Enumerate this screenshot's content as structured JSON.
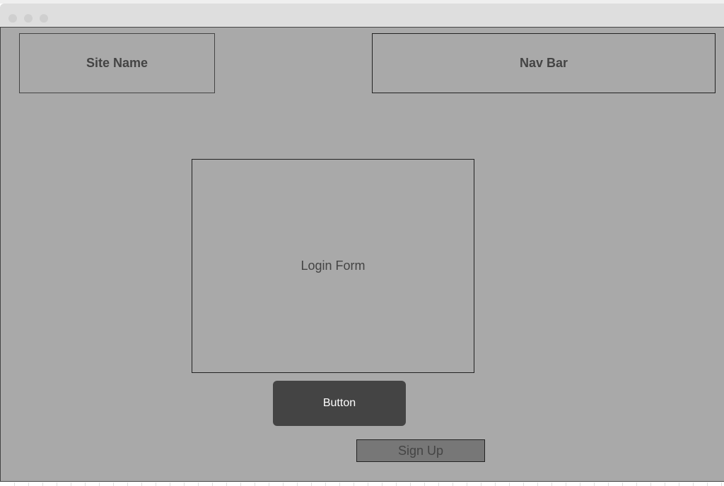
{
  "header": {
    "site_name": "Site Name",
    "nav_bar": "Nav Bar"
  },
  "main": {
    "login_form": "Login Form",
    "button_label": "Button",
    "signup_label": "Sign Up"
  }
}
